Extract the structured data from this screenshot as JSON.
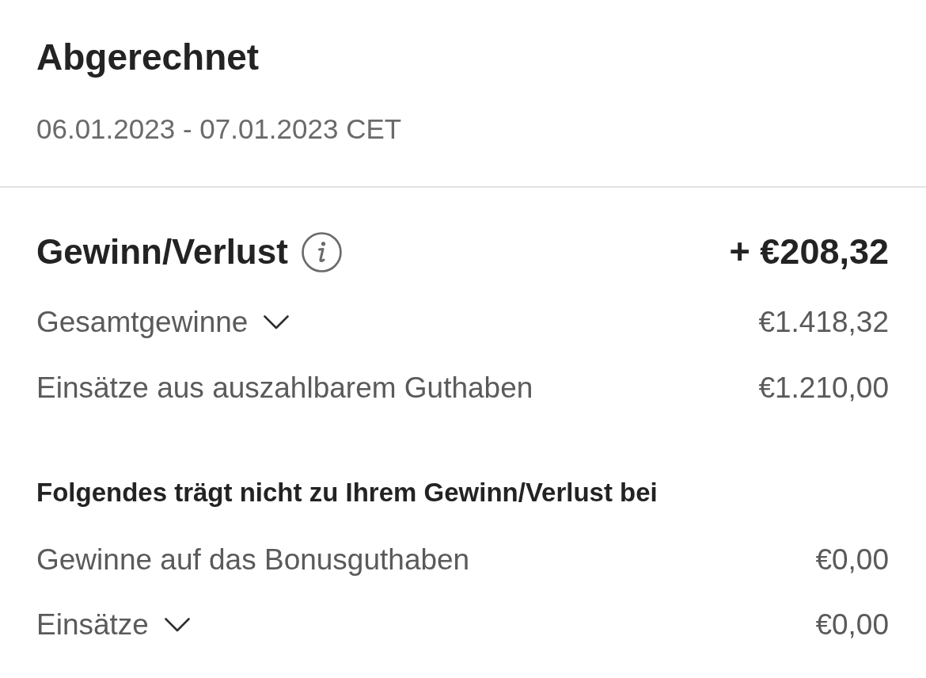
{
  "header": {
    "title": "Abgerechnet",
    "period": "06.01.2023 - 07.01.2023 CET"
  },
  "summary": {
    "label": "Gewinn/Verlust",
    "amount": "+ €208,32"
  },
  "rows": [
    {
      "kind": "expandable",
      "label": "Gesamtgewinne",
      "value": "€1.418,32",
      "expanded": false
    },
    {
      "kind": "plain",
      "label": "Einsätze aus auszahlbarem Guthaben",
      "value": "€1.210,00"
    }
  ],
  "excluded": {
    "heading": "Folgendes trägt nicht zu Ihrem Gewinn/Verlust bei",
    "rows": [
      {
        "kind": "plain",
        "label": "Gewinne auf das Bonusguthaben",
        "value": "€0,00"
      },
      {
        "kind": "expandable",
        "label": "Einsätze",
        "value": "€0,00",
        "expanded": false
      }
    ]
  }
}
